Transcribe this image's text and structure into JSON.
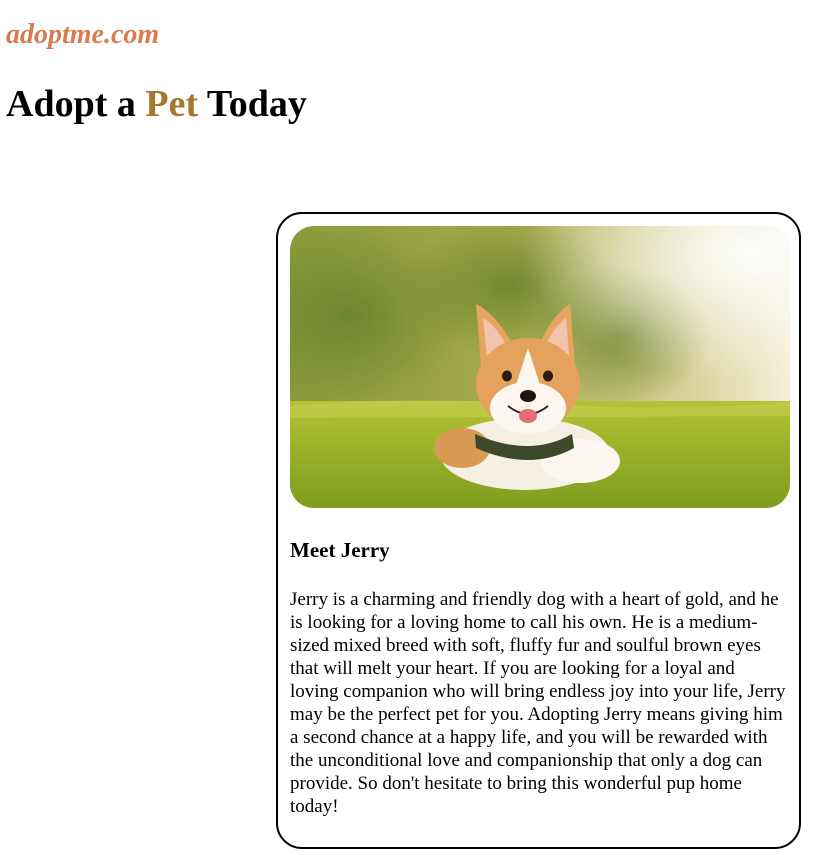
{
  "site": {
    "brand": "adoptme.com"
  },
  "page": {
    "heading_before": "Adopt a ",
    "heading_accent": "Pet",
    "heading_after": " Today"
  },
  "pet_card": {
    "image_icon": "corgi-photo",
    "title": "Meet Jerry",
    "description": "Jerry is a charming and friendly dog with a heart of gold, and he is looking for a loving home to call his own. He is a medium-sized mixed breed with soft, fluffy fur and soulful brown eyes that will melt your heart. If you are looking for a loyal and loving companion who will bring endless joy into your life, Jerry may be the perfect pet for you. Adopting Jerry means giving him a second chance at a happy life, and you will be rewarded with the unconditional love and companionship that only a dog can provide. So don't hesitate to bring this wonderful pup home today!"
  },
  "colors": {
    "brand": "#d97b4f",
    "accent": "#a57730",
    "card_border": "#000000"
  }
}
